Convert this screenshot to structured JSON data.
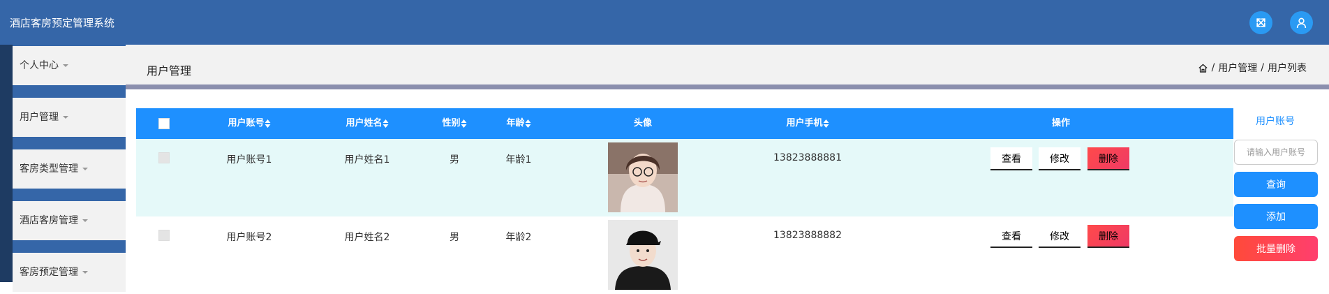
{
  "header": {
    "app_title": "酒店客房预定管理系统",
    "icons": [
      "fullscreen-icon",
      "user-icon"
    ]
  },
  "sidebar": {
    "items": [
      {
        "label": "个人中心"
      },
      {
        "label": "用户管理"
      },
      {
        "label": "客房类型管理"
      },
      {
        "label": "酒店客房管理"
      },
      {
        "label": "客房预定管理"
      }
    ]
  },
  "page": {
    "title": "用户管理",
    "breadcrumb": {
      "sep": "/",
      "items": [
        "用户管理",
        "用户列表"
      ]
    }
  },
  "table": {
    "headers": {
      "account": "用户账号",
      "name": "用户姓名",
      "gender": "性别",
      "age": "年龄",
      "avatar": "头像",
      "phone": "用户手机",
      "actions": "操作"
    },
    "rows": [
      {
        "account": "用户账号1",
        "name": "用户姓名1",
        "gender": "男",
        "age": "年龄1",
        "phone": "13823888881"
      },
      {
        "account": "用户账号2",
        "name": "用户姓名2",
        "gender": "男",
        "age": "年龄2",
        "phone": "13823888882"
      }
    ],
    "actions": {
      "view": "查看",
      "edit": "修改",
      "delete": "删除"
    }
  },
  "search": {
    "label": "用户账号",
    "placeholder": "请输入用户账号",
    "query_button": "查询",
    "add_button": "添加",
    "batch_delete_button": "批量删除"
  },
  "colors": {
    "header_bg": "#3566a8",
    "table_header": "#1e90ff",
    "row_highlight": "#e5f9f9",
    "delete": "#ff4a4a"
  }
}
